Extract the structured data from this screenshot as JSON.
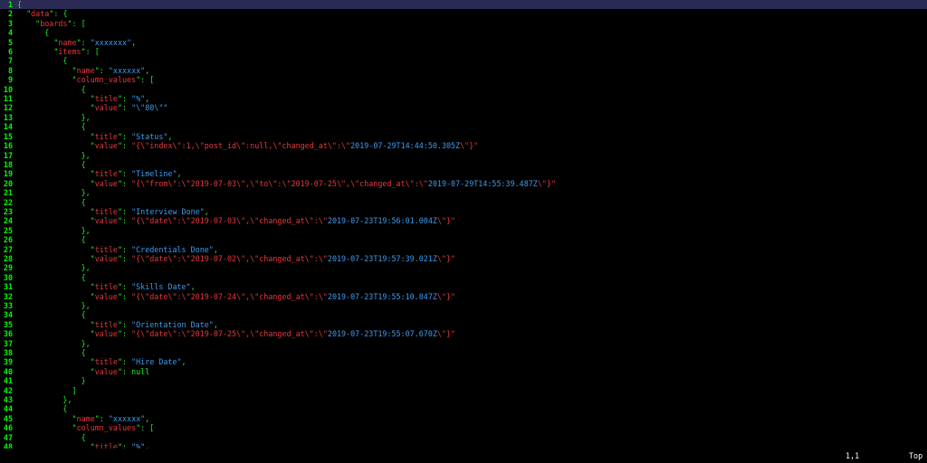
{
  "editor": {
    "lines": [
      {
        "n": "1",
        "segs": [
          [
            "p",
            "{"
          ]
        ],
        "current": true
      },
      {
        "n": "2",
        "segs": [
          [
            "p",
            "  \""
          ],
          [
            "k",
            "data"
          ],
          [
            "p",
            "\": {"
          ]
        ]
      },
      {
        "n": "3",
        "segs": [
          [
            "p",
            "    \""
          ],
          [
            "k",
            "boards"
          ],
          [
            "p",
            "\": ["
          ]
        ]
      },
      {
        "n": "4",
        "segs": [
          [
            "p",
            "      {"
          ]
        ]
      },
      {
        "n": "5",
        "segs": [
          [
            "p",
            "        \""
          ],
          [
            "k",
            "name"
          ],
          [
            "p",
            "\": "
          ],
          [
            "s",
            "\"xxxxxxx\""
          ],
          [
            "p",
            ","
          ]
        ]
      },
      {
        "n": "6",
        "segs": [
          [
            "p",
            "        \""
          ],
          [
            "k",
            "items"
          ],
          [
            "p",
            "\": ["
          ]
        ]
      },
      {
        "n": "7",
        "segs": [
          [
            "p",
            "          {"
          ]
        ]
      },
      {
        "n": "8",
        "segs": [
          [
            "p",
            "            \""
          ],
          [
            "k",
            "name"
          ],
          [
            "p",
            "\": "
          ],
          [
            "s",
            "\"xxxxxx\""
          ],
          [
            "p",
            ","
          ]
        ]
      },
      {
        "n": "9",
        "segs": [
          [
            "p",
            "            \""
          ],
          [
            "k",
            "column_values"
          ],
          [
            "p",
            "\": ["
          ]
        ]
      },
      {
        "n": "10",
        "segs": [
          [
            "p",
            "              {"
          ]
        ]
      },
      {
        "n": "11",
        "segs": [
          [
            "p",
            "                \""
          ],
          [
            "k",
            "title"
          ],
          [
            "p",
            "\": "
          ],
          [
            "s",
            "\"%\""
          ],
          [
            "p",
            ","
          ]
        ]
      },
      {
        "n": "12",
        "segs": [
          [
            "p",
            "                \""
          ],
          [
            "k",
            "value"
          ],
          [
            "p",
            "\": "
          ],
          [
            "s",
            "\"\\\"80\\\"\""
          ]
        ]
      },
      {
        "n": "13",
        "segs": [
          [
            "p",
            "              },"
          ]
        ]
      },
      {
        "n": "14",
        "segs": [
          [
            "p",
            "              {"
          ]
        ]
      },
      {
        "n": "15",
        "segs": [
          [
            "p",
            "                \""
          ],
          [
            "k",
            "title"
          ],
          [
            "p",
            "\": "
          ],
          [
            "s",
            "\"Status\""
          ],
          [
            "p",
            ","
          ]
        ]
      },
      {
        "n": "16",
        "segs": [
          [
            "p",
            "                \""
          ],
          [
            "k",
            "value"
          ],
          [
            "p",
            "\": "
          ],
          [
            "k",
            "\"{\\\"index\\\":1,\\\"post_id\\\":null,\\\"changed_at\\\":\\\""
          ],
          [
            "s",
            "2019-07-29T14:44:50.305Z"
          ],
          [
            "k",
            "\\\"}\""
          ]
        ]
      },
      {
        "n": "17",
        "segs": [
          [
            "p",
            "              },"
          ]
        ]
      },
      {
        "n": "18",
        "segs": [
          [
            "p",
            "              {"
          ]
        ]
      },
      {
        "n": "19",
        "segs": [
          [
            "p",
            "                \""
          ],
          [
            "k",
            "title"
          ],
          [
            "p",
            "\": "
          ],
          [
            "s",
            "\"Timeline\""
          ],
          [
            "p",
            ","
          ]
        ]
      },
      {
        "n": "20",
        "segs": [
          [
            "p",
            "                \""
          ],
          [
            "k",
            "value"
          ],
          [
            "p",
            "\": "
          ],
          [
            "k",
            "\"{\\\"from\\\":\\\"2019-07-03\\\",\\\"to\\\":\\\"2019-07-25\\\",\\\"changed_at\\\":\\\""
          ],
          [
            "s",
            "2019-07-29T14:55:39.487Z"
          ],
          [
            "k",
            "\\\"}\""
          ]
        ]
      },
      {
        "n": "21",
        "segs": [
          [
            "p",
            "              },"
          ]
        ]
      },
      {
        "n": "22",
        "segs": [
          [
            "p",
            "              {"
          ]
        ]
      },
      {
        "n": "23",
        "segs": [
          [
            "p",
            "                \""
          ],
          [
            "k",
            "title"
          ],
          [
            "p",
            "\": "
          ],
          [
            "s",
            "\"Interview Done\""
          ],
          [
            "p",
            ","
          ]
        ]
      },
      {
        "n": "24",
        "segs": [
          [
            "p",
            "                \""
          ],
          [
            "k",
            "value"
          ],
          [
            "p",
            "\": "
          ],
          [
            "k",
            "\"{\\\"date\\\":\\\"2019-07-03\\\",\\\"changed_at\\\":\\\""
          ],
          [
            "s",
            "2019-07-23T19:56:01.004Z"
          ],
          [
            "k",
            "\\\"}\""
          ]
        ]
      },
      {
        "n": "25",
        "segs": [
          [
            "p",
            "              },"
          ]
        ]
      },
      {
        "n": "26",
        "segs": [
          [
            "p",
            "              {"
          ]
        ]
      },
      {
        "n": "27",
        "segs": [
          [
            "p",
            "                \""
          ],
          [
            "k",
            "title"
          ],
          [
            "p",
            "\": "
          ],
          [
            "s",
            "\"Credentials Done\""
          ],
          [
            "p",
            ","
          ]
        ]
      },
      {
        "n": "28",
        "segs": [
          [
            "p",
            "                \""
          ],
          [
            "k",
            "value"
          ],
          [
            "p",
            "\": "
          ],
          [
            "k",
            "\"{\\\"date\\\":\\\"2019-07-02\\\",\\\"changed_at\\\":\\\""
          ],
          [
            "s",
            "2019-07-23T19:57:39.021Z"
          ],
          [
            "k",
            "\\\"}\""
          ]
        ]
      },
      {
        "n": "29",
        "segs": [
          [
            "p",
            "              },"
          ]
        ]
      },
      {
        "n": "30",
        "segs": [
          [
            "p",
            "              {"
          ]
        ]
      },
      {
        "n": "31",
        "segs": [
          [
            "p",
            "                \""
          ],
          [
            "k",
            "title"
          ],
          [
            "p",
            "\": "
          ],
          [
            "s",
            "\"Skills Date\""
          ],
          [
            "p",
            ","
          ]
        ]
      },
      {
        "n": "32",
        "segs": [
          [
            "p",
            "                \""
          ],
          [
            "k",
            "value"
          ],
          [
            "p",
            "\": "
          ],
          [
            "k",
            "\"{\\\"date\\\":\\\"2019-07-24\\\",\\\"changed_at\\\":\\\""
          ],
          [
            "s",
            "2019-07-23T19:55:10.847Z"
          ],
          [
            "k",
            "\\\"}\""
          ]
        ]
      },
      {
        "n": "33",
        "segs": [
          [
            "p",
            "              },"
          ]
        ]
      },
      {
        "n": "34",
        "segs": [
          [
            "p",
            "              {"
          ]
        ]
      },
      {
        "n": "35",
        "segs": [
          [
            "p",
            "                \""
          ],
          [
            "k",
            "title"
          ],
          [
            "p",
            "\": "
          ],
          [
            "s",
            "\"Orientation Date\""
          ],
          [
            "p",
            ","
          ]
        ]
      },
      {
        "n": "36",
        "segs": [
          [
            "p",
            "                \""
          ],
          [
            "k",
            "value"
          ],
          [
            "p",
            "\": "
          ],
          [
            "k",
            "\"{\\\"date\\\":\\\"2019-07-25\\\",\\\"changed_at\\\":\\\""
          ],
          [
            "s",
            "2019-07-23T19:55:07.670Z"
          ],
          [
            "k",
            "\\\"}\""
          ]
        ]
      },
      {
        "n": "37",
        "segs": [
          [
            "p",
            "              },"
          ]
        ]
      },
      {
        "n": "38",
        "segs": [
          [
            "p",
            "              {"
          ]
        ]
      },
      {
        "n": "39",
        "segs": [
          [
            "p",
            "                \""
          ],
          [
            "k",
            "title"
          ],
          [
            "p",
            "\": "
          ],
          [
            "s",
            "\"Hire Date\""
          ],
          [
            "p",
            ","
          ]
        ]
      },
      {
        "n": "40",
        "segs": [
          [
            "p",
            "                \""
          ],
          [
            "k",
            "value"
          ],
          [
            "p",
            "\": "
          ],
          [
            "v",
            "null"
          ]
        ]
      },
      {
        "n": "41",
        "segs": [
          [
            "p",
            "              }"
          ]
        ]
      },
      {
        "n": "42",
        "segs": [
          [
            "p",
            "            ]"
          ]
        ]
      },
      {
        "n": "43",
        "segs": [
          [
            "p",
            "          },"
          ]
        ]
      },
      {
        "n": "44",
        "segs": [
          [
            "p",
            "          {"
          ]
        ]
      },
      {
        "n": "45",
        "segs": [
          [
            "p",
            "            \""
          ],
          [
            "k",
            "name"
          ],
          [
            "p",
            "\": "
          ],
          [
            "s",
            "\"xxxxxx\""
          ],
          [
            "p",
            ","
          ]
        ]
      },
      {
        "n": "46",
        "segs": [
          [
            "p",
            "            \""
          ],
          [
            "k",
            "column_values"
          ],
          [
            "p",
            "\": ["
          ]
        ]
      },
      {
        "n": "47",
        "segs": [
          [
            "p",
            "              {"
          ]
        ]
      },
      {
        "n": "48",
        "segs": [
          [
            "p",
            "                \""
          ],
          [
            "k",
            "title"
          ],
          [
            "p",
            "\": "
          ],
          [
            "s",
            "\"%\""
          ],
          [
            "p",
            ","
          ]
        ]
      }
    ]
  },
  "statusbar": {
    "cursor_position": "1,1",
    "scroll_position": "Top"
  },
  "colors": {
    "background": "#000000",
    "line_number": "#00ff00",
    "punctuation": "#22ee22",
    "key": "#e8383d",
    "string": "#3c9cf0",
    "literal": "#22ee22",
    "current_line": "#2a2a55"
  }
}
